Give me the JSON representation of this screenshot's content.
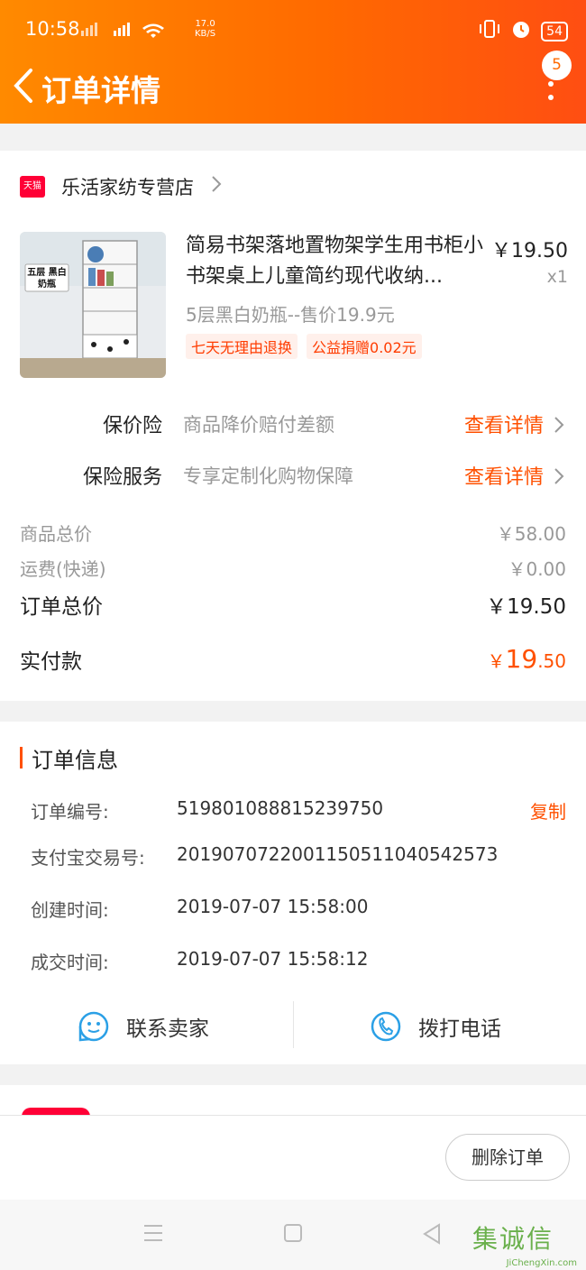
{
  "status_bar": {
    "time": "10:58",
    "signal_text": "4G",
    "speed_value": "17.0",
    "speed_unit": "KB/S",
    "battery": "54"
  },
  "header": {
    "title": "订单详情",
    "badge_count": "5"
  },
  "shop": {
    "platform_label": "天猫",
    "name": "乐活家纺专营店"
  },
  "product": {
    "title": "简易书架落地置物架学生用书柜小书架桌上儿童简约现代收纳...",
    "price": "￥19.50",
    "quantity": "x1",
    "sku": "5层黑白奶瓶--售价19.9元",
    "tags": [
      "七天无理由退换",
      "公益捐赠0.02元"
    ],
    "image_caption": "五层 黑白奶瓶"
  },
  "services": [
    {
      "label": "保价险",
      "desc": "商品降价赔付差额",
      "link": "查看详情"
    },
    {
      "label": "保险服务",
      "desc": "专享定制化购物保障",
      "link": "查看详情"
    }
  ],
  "summary": {
    "goods_total_label": "商品总价",
    "goods_total": "￥58.00",
    "shipping_label": "运费(快递)",
    "shipping": "￥0.00",
    "order_total_label": "订单总价",
    "order_total": "￥19.50",
    "paid_label": "实付款",
    "paid_currency": "￥",
    "paid_integer": "19",
    "paid_decimal": ".50"
  },
  "order_info": {
    "section_title": "订单信息",
    "order_no_label": "订单编号:",
    "order_no": "519801088815239750",
    "copy_label": "复制",
    "alipay_label": "支付宝交易号:",
    "alipay_no": "2019070722001150511040542573",
    "created_label": "创建时间:",
    "created": "2019-07-07 15:58:00",
    "closed_label": "成交时间:",
    "closed": "2019-07-07 15:58:12"
  },
  "actions": {
    "contact_seller": "联系卖家",
    "call": "拨打电话"
  },
  "footer": {
    "delete_order": "删除订单"
  },
  "watermark": {
    "text": "集诚信",
    "url": "JiChengXin.com"
  },
  "colors": {
    "accent": "#ff5000",
    "header_start": "#ff8a00",
    "header_end": "#ff4e12",
    "tmall_red": "#ff0036",
    "icon_blue": "#2ba0e6"
  }
}
